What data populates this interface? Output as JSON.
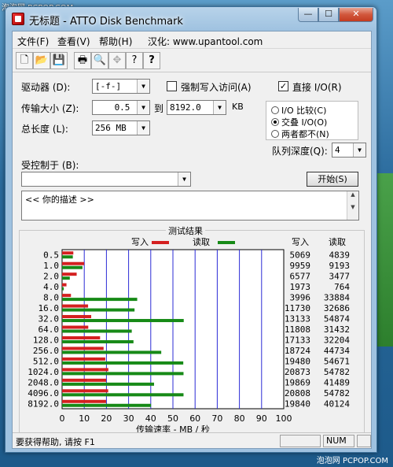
{
  "watermark": {
    "top": "泡泡网 PCPOP.COM",
    "bottom": "泡泡网 PCPOP.COM"
  },
  "window": {
    "title": "无标题 - ATTO Disk Benchmark",
    "minimize": "—",
    "maximize": "☐",
    "close": "✕"
  },
  "menu": {
    "file": "文件(F)",
    "view": "查看(V)",
    "help": "帮助(H)",
    "credit": "汉化: www.upantool.com"
  },
  "toolbar": {
    "new": "🗋",
    "open": "📂",
    "save": "💾",
    "print": "🖶",
    "preview": "🔍",
    "move": "✥",
    "help": "?",
    "whatsthis": "?"
  },
  "settings": {
    "drive_label": "驱动器 (D):",
    "drive_value": "[-f-]",
    "force_write_label": "强制写入访问(A)",
    "force_write_checked": false,
    "direct_io_label": "直接 I/O(R)",
    "direct_io_checked": true,
    "transfer_label": "传输大小 (Z):",
    "transfer_from": "0.5",
    "transfer_to_label": "到",
    "transfer_to": "8192.0",
    "transfer_unit": "KB",
    "length_label": "总长度 (L):",
    "length_value": "256 MB",
    "io_options": [
      "I/O 比较(C)",
      "交叠 I/O(O)",
      "两者都不(N)"
    ],
    "io_selected": 1,
    "queue_label": "队列深度(Q):",
    "queue_value": "4",
    "controlled_label": "受控制于 (B):",
    "controlled_value": "",
    "start_label": "开始(S)",
    "description": "<<  你的描述  >>"
  },
  "results": {
    "title": "测试结果",
    "write_legend": "写入",
    "read_legend": "读取",
    "write_header": "写入",
    "read_header": "读取"
  },
  "chart_data": {
    "type": "bar",
    "orientation": "horizontal",
    "title": "测试结果",
    "xlabel": "传输速率 - MB / 秒",
    "xlim": [
      0,
      100
    ],
    "xticks": [
      0,
      10,
      20,
      30,
      40,
      50,
      60,
      70,
      80,
      90,
      100
    ],
    "categories": [
      "0.5",
      "1.0",
      "2.0",
      "4.0",
      "8.0",
      "16.0",
      "32.0",
      "64.0",
      "128.0",
      "256.0",
      "512.0",
      "1024.0",
      "2048.0",
      "4096.0",
      "8192.0"
    ],
    "series": [
      {
        "name": "写入",
        "color": "#d42020",
        "values": [
          5.069,
          9.959,
          6.577,
          1.973,
          3.996,
          11.73,
          13.133,
          11.808,
          17.133,
          18.724,
          19.48,
          20.873,
          19.869,
          20.808,
          19.84
        ]
      },
      {
        "name": "读取",
        "color": "#178a17",
        "values": [
          4.839,
          9.193,
          3.477,
          0.764,
          33.884,
          32.686,
          54.874,
          31.432,
          32.204,
          44.734,
          54.671,
          54.782,
          41.489,
          54.782,
          40.124
        ]
      }
    ],
    "table": {
      "write": [
        "5069",
        "9959",
        "6577",
        "1973",
        "3996",
        "11730",
        "13133",
        "11808",
        "17133",
        "18724",
        "19480",
        "20873",
        "19869",
        "20808",
        "19840"
      ],
      "read": [
        "4839",
        "9193",
        "3477",
        "764",
        "33884",
        "32686",
        "54874",
        "31432",
        "32204",
        "44734",
        "54671",
        "54782",
        "41489",
        "54782",
        "40124"
      ]
    },
    "grid": true,
    "legend": "top-center"
  },
  "status": {
    "text": "要获得帮助, 请按 F1",
    "num": "NUM"
  }
}
